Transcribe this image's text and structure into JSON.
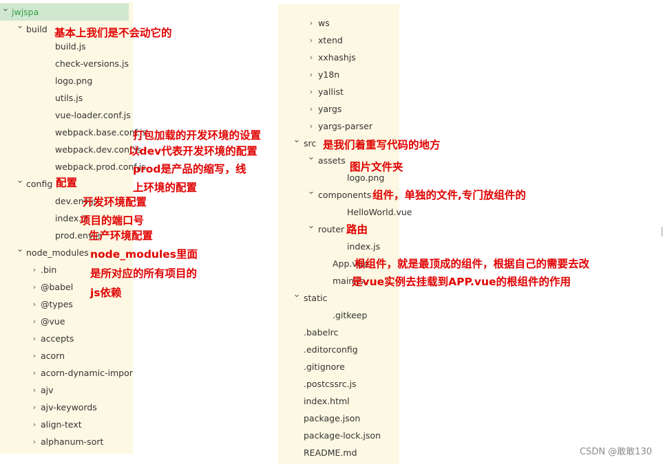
{
  "left_tree": [
    {
      "label": "jwjspa",
      "chevron": "down",
      "level": 0,
      "root": true
    },
    {
      "label": "build",
      "chevron": "down",
      "level": 1
    },
    {
      "label": "build.js",
      "level": 3
    },
    {
      "label": "check-versions.js",
      "level": 3
    },
    {
      "label": "logo.png",
      "level": 3
    },
    {
      "label": "utils.js",
      "level": 3
    },
    {
      "label": "vue-loader.conf.js",
      "level": 3
    },
    {
      "label": "webpack.base.conf.js",
      "level": 3
    },
    {
      "label": "webpack.dev.conf.js",
      "level": 3
    },
    {
      "label": "webpack.prod.conf.js",
      "level": 3
    },
    {
      "label": "config",
      "chevron": "down",
      "level": 1
    },
    {
      "label": "dev.env.js",
      "level": 3
    },
    {
      "label": "index.js",
      "level": 3
    },
    {
      "label": "prod.env.js",
      "level": 3
    },
    {
      "label": "node_modules",
      "chevron": "down",
      "level": 1
    },
    {
      "label": ".bin",
      "chevron": "right",
      "level": 2
    },
    {
      "label": "@babel",
      "chevron": "right",
      "level": 2
    },
    {
      "label": "@types",
      "chevron": "right",
      "level": 2
    },
    {
      "label": "@vue",
      "chevron": "right",
      "level": 2
    },
    {
      "label": "accepts",
      "chevron": "right",
      "level": 2
    },
    {
      "label": "acorn",
      "chevron": "right",
      "level": 2
    },
    {
      "label": "acorn-dynamic-impor",
      "chevron": "right",
      "level": 2
    },
    {
      "label": "ajv",
      "chevron": "right",
      "level": 2
    },
    {
      "label": "ajv-keywords",
      "chevron": "right",
      "level": 2
    },
    {
      "label": "align-text",
      "chevron": "right",
      "level": 2
    },
    {
      "label": "alphanum-sort",
      "chevron": "right",
      "level": 2
    }
  ],
  "right_tree": [
    {
      "label": "ws",
      "chevron": "right",
      "level": 2
    },
    {
      "label": "xtend",
      "chevron": "right",
      "level": 2
    },
    {
      "label": "xxhashjs",
      "chevron": "right",
      "level": 2
    },
    {
      "label": "y18n",
      "chevron": "right",
      "level": 2
    },
    {
      "label": "yallist",
      "chevron": "right",
      "level": 2
    },
    {
      "label": "yargs",
      "chevron": "right",
      "level": 2
    },
    {
      "label": "yargs-parser",
      "chevron": "right",
      "level": 2
    },
    {
      "label": "src",
      "chevron": "down",
      "level": 1
    },
    {
      "label": "assets",
      "chevron": "down",
      "level": 2
    },
    {
      "label": "logo.png",
      "level": 4
    },
    {
      "label": "components",
      "chevron": "down",
      "level": 2
    },
    {
      "label": "HelloWorld.vue",
      "level": 4
    },
    {
      "label": "router",
      "chevron": "down",
      "level": 2
    },
    {
      "label": "index.js",
      "level": 4
    },
    {
      "label": "App.vue",
      "level": 3
    },
    {
      "label": "main.js",
      "level": 3
    },
    {
      "label": "static",
      "chevron": "down",
      "level": 1
    },
    {
      "label": ".gitkeep",
      "level": 3
    },
    {
      "label": ".babelrc",
      "level": 1
    },
    {
      "label": ".editorconfig",
      "level": 1
    },
    {
      "label": ".gitignore",
      "level": 1
    },
    {
      "label": ".postcssrc.js",
      "level": 1
    },
    {
      "label": "index.html",
      "level": 1
    },
    {
      "label": "package.json",
      "level": 1
    },
    {
      "label": "package-lock.json",
      "level": 1
    },
    {
      "label": "README.md",
      "level": 1
    }
  ],
  "annotations": {
    "build": "基本上我们是不会动它的",
    "webpack_base": "打包加载的开发环境的设置",
    "webpack_dev": "以dev代表开发环境的配置",
    "webpack_prod_1": "prod是产品的缩写，线",
    "webpack_prod_2": "上环境的配置",
    "config": "配置",
    "dev_env": "开发环境配置",
    "index_js": "项目的端口号",
    "prod_env": "生产环境配置",
    "node_modules_1": "node_modules里面",
    "node_modules_2": "是所对应的所有项目的",
    "node_modules_3": "js依赖",
    "src": "是我们着重写代码的地方",
    "assets": "图片文件夹",
    "components": "组件，单独的文件,专门放组件的",
    "router": "路由",
    "app_vue": "根组件，就是最顶成的组件，根据自己的需要去改",
    "main_js": "是vue实例去挂载到APP.vue的根组件的作用"
  },
  "icons": {
    "expanded": "chevron-down-icon",
    "collapsed": "chevron-right-icon"
  },
  "colors": {
    "panel_bg": "#fcf8e3",
    "selection_bg": "#cfe8cf",
    "root_text": "#3aa04a",
    "annotation": "#e00000"
  },
  "watermark": "CSDN @敢敢130"
}
